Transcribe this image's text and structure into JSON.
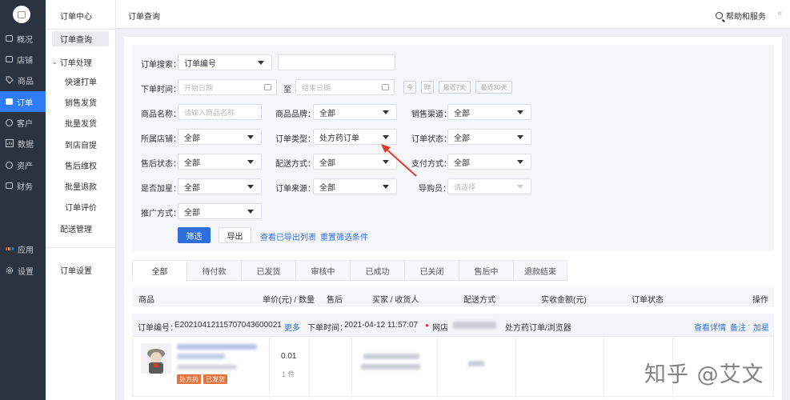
{
  "nav": {
    "items": [
      {
        "label": "概况",
        "icon": "monitor-icon"
      },
      {
        "label": "店铺",
        "icon": "store-icon"
      },
      {
        "label": "商品",
        "icon": "tag-icon"
      },
      {
        "label": "订单",
        "icon": "order-icon",
        "active": true
      },
      {
        "label": "客户",
        "icon": "user-icon"
      },
      {
        "label": "数据",
        "icon": "chart-icon"
      },
      {
        "label": "资产",
        "icon": "coin-icon"
      },
      {
        "label": "财务",
        "icon": "wallet-icon"
      }
    ],
    "apps_label": "应用",
    "settings_label": "设置"
  },
  "subnav": {
    "title": "订单中心",
    "query": "订单查询",
    "group": "订单处理",
    "children": [
      "快速打单",
      "销售发货",
      "批量发货",
      "到店自提",
      "售后维权",
      "批量退款",
      "订单评价"
    ],
    "delivery": "配送管理",
    "settings": "订单设置"
  },
  "topbar": {
    "crumb": "订单查询",
    "help": "帮助和服务",
    "collapse": "«"
  },
  "filter": {
    "search_label": "订单搜索：",
    "search_type": "订单编号",
    "search_value": "",
    "time_label": "下单时间：",
    "start_placeholder": "开始日期",
    "to": "至",
    "end_placeholder": "结束日期",
    "quick": [
      "今",
      "昨",
      "最近7天",
      "最近30天"
    ],
    "product_label": "商品名称：",
    "product_placeholder": "请输入商品名称",
    "brand_label": "商品品牌：",
    "brand_value": "全部",
    "channel_label": "销售渠道：",
    "channel_value": "全部",
    "store_label": "所属店铺：",
    "store_value": "全部",
    "type_label": "订单类型：",
    "type_value": "处方药订单",
    "status_label": "订单状态：",
    "status_value": "全部",
    "aftersale_label": "售后状态：",
    "aftersale_value": "全部",
    "delivery_label": "配送方式：",
    "delivery_value": "全部",
    "pay_label": "支付方式：",
    "pay_value": "全部",
    "star_label": "是否加星：",
    "star_value": "全部",
    "source_label": "订单来源：",
    "source_value": "全部",
    "guide_label": "导购员：",
    "guide_placeholder": "请选择",
    "promo_label": "推广方式：",
    "promo_value": "全部",
    "filter_btn": "筛选",
    "export_btn": "导出",
    "view_exports": "查看已导出列表",
    "reset": "重置筛选条件"
  },
  "tabs": [
    "全部",
    "待付款",
    "已发货",
    "审核中",
    "已成功",
    "已关闭",
    "售后中",
    "退款结束"
  ],
  "table": {
    "headers": [
      "商品",
      "单价(元) / 数量",
      "售后",
      "买家 / 收货人",
      "配送方式",
      "实收金额(元)",
      "订单状态",
      "操作"
    ]
  },
  "order": {
    "no_label": "订单编号：",
    "no": "E20210412115707043600021",
    "more": "更多",
    "time_label": "下单时间：",
    "time": "2021-04-12 11:57:07",
    "store_prefix": "网店",
    "type_text": "处方药订单/浏览器",
    "actions": [
      "查看详情",
      "备注",
      "加星"
    ],
    "price": "0.01",
    "qty": "1 件",
    "tags": [
      "处方药",
      "已发货"
    ]
  },
  "colors": {
    "nav_bg": "#2b3240",
    "accent": "#2f7cf6",
    "link": "#2f6fdc",
    "tag_orange": "#e8733a",
    "arrow_red": "#e23b2e"
  },
  "watermark": "知乎 @艾文"
}
